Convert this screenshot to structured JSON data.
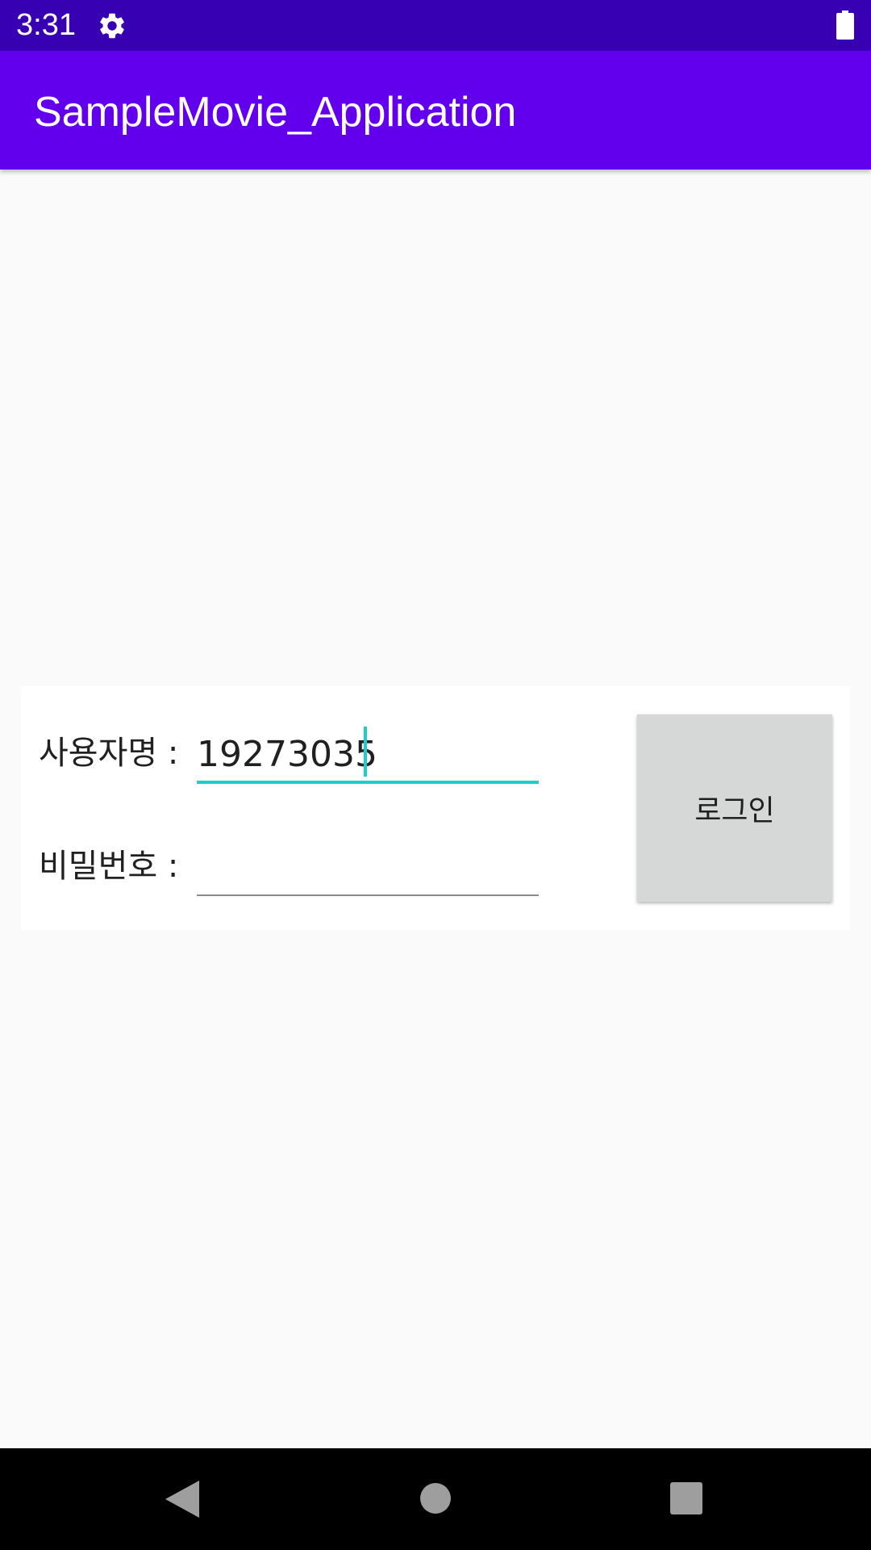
{
  "status_bar": {
    "time": "3:31",
    "icons": [
      "gear-icon",
      "battery-icon"
    ]
  },
  "app_bar": {
    "title": "SampleMovie_Application"
  },
  "login_form": {
    "username_label": "사용자명 :",
    "username_value": "19273035",
    "password_label": "비밀번호 :",
    "password_value": "",
    "login_button_label": "로그인"
  },
  "nav_bar": {
    "icons": [
      "back-icon",
      "home-icon",
      "recents-icon"
    ]
  },
  "colors": {
    "status_bar": "#3700b3",
    "app_bar": "#6200ee",
    "accent": "#1dcfc8",
    "button": "#d6d7d7",
    "background": "#fafafa"
  }
}
